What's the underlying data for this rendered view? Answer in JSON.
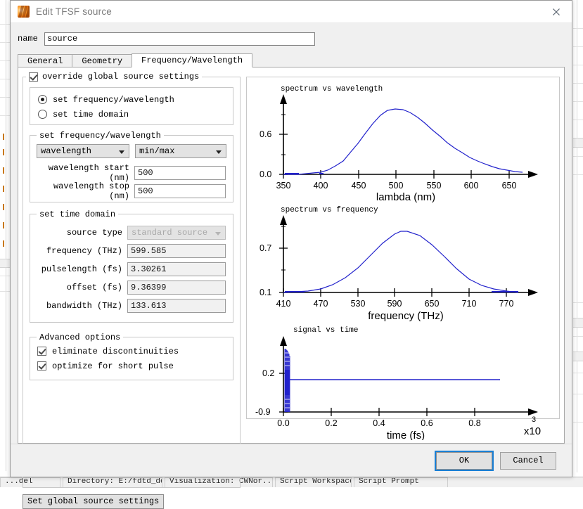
{
  "window": {
    "title": "Edit TFSF source",
    "app_icon": "lumerical-flame-icon",
    "close_icon": "close-icon"
  },
  "name_field": {
    "label": "name",
    "value": "source",
    "placeholder": ""
  },
  "tabs": [
    {
      "label": "General",
      "active": false
    },
    {
      "label": "Geometry",
      "active": false
    },
    {
      "label": "Frequency/Wavelength",
      "active": true
    }
  ],
  "override_group": {
    "legend": "override global source settings",
    "checked": true
  },
  "mode_group": {
    "options": [
      {
        "label": "set frequency/wavelength",
        "selected": true
      },
      {
        "label": "set time domain",
        "selected": false
      }
    ]
  },
  "frequency_group": {
    "legend": "set frequency/wavelength",
    "quantity_select": {
      "value": "wavelength"
    },
    "range_select": {
      "value": "min/max"
    },
    "fields": [
      {
        "label": "wavelength start (nm)",
        "value": "500"
      },
      {
        "label": "wavelength stop (nm)",
        "value": "500"
      }
    ]
  },
  "time_group": {
    "legend": "set time domain",
    "source_type": {
      "label": "source type",
      "value": "standard source",
      "disabled": true
    },
    "fields": [
      {
        "label": "frequency (THz)",
        "value": "599.585"
      },
      {
        "label": "pulselength (fs)",
        "value": "3.30261"
      },
      {
        "label": "offset (fs)",
        "value": "9.36399"
      },
      {
        "label": "bandwidth (THz)",
        "value": "133.613"
      }
    ]
  },
  "advanced_group": {
    "legend": "Advanced options",
    "options": [
      {
        "label": "eliminate discontinuities",
        "checked": true
      },
      {
        "label": "optimize for short pulse",
        "checked": true
      }
    ]
  },
  "set_global_button": {
    "label": "Set global source settings"
  },
  "footer": {
    "ok_label": "OK",
    "cancel_label": "Cancel",
    "default_button": "OK"
  },
  "colors": {
    "curve": "#2222cc",
    "axis": "#000000",
    "tick_label": "#000000",
    "focus_ring": "#1a7fd4",
    "dialog_bg": "#f0f0f0",
    "accent_icon": "#f07c12"
  },
  "host_statusbar": {
    "cells": [
      "...del",
      "Directory: E:/fdtd_dev...",
      "Visualization: CWNor...",
      "Script Workspace",
      "Script Prompt"
    ]
  },
  "chart_data": [
    {
      "id": "spectrum-vs-wavelength",
      "type": "line",
      "title": "spectrum vs wavelength",
      "xlabel": "lambda (nm)",
      "ylabel": "",
      "xlim": [
        350,
        667
      ],
      "ylim": [
        0.0,
        1.0
      ],
      "xticks": [
        350,
        400,
        450,
        500,
        550,
        600,
        650
      ],
      "yticks": [
        0.0,
        0.6
      ],
      "ytick_labels": [
        "0.0",
        "0.6"
      ],
      "grid": false,
      "legend": "none",
      "series": [
        {
          "name": "spectrum",
          "x": [
            350,
            360,
            370,
            380,
            390,
            400,
            410,
            420,
            430,
            440,
            450,
            460,
            470,
            480,
            490,
            500,
            510,
            520,
            530,
            540,
            550,
            560,
            570,
            580,
            590,
            600,
            610,
            620,
            630,
            640,
            650,
            660,
            667
          ],
          "y": [
            0.0,
            0.0,
            0.0,
            0.005,
            0.012,
            0.028,
            0.06,
            0.115,
            0.2,
            0.31,
            0.44,
            0.58,
            0.71,
            0.82,
            0.885,
            0.905,
            0.895,
            0.86,
            0.8,
            0.73,
            0.645,
            0.56,
            0.475,
            0.395,
            0.325,
            0.26,
            0.21,
            0.165,
            0.125,
            0.095,
            0.07,
            0.05,
            0.04
          ]
        }
      ]
    },
    {
      "id": "spectrum-vs-frequency",
      "type": "line",
      "title": "spectrum vs frequency",
      "xlabel": "frequency (THz)",
      "ylabel": "",
      "xlim": [
        410,
        790
      ],
      "ylim": [
        0.1,
        1.0
      ],
      "xticks": [
        410,
        470,
        530,
        590,
        650,
        710,
        770
      ],
      "yticks": [
        0.1,
        0.7
      ],
      "ytick_labels": [
        "0.1",
        "0.7"
      ],
      "grid": false,
      "legend": "none",
      "series": [
        {
          "name": "spectrum",
          "x": [
            410,
            430,
            450,
            470,
            490,
            510,
            530,
            550,
            570,
            590,
            600,
            610,
            630,
            650,
            670,
            690,
            710,
            730,
            750,
            770,
            790
          ],
          "y": [
            0.1,
            0.105,
            0.115,
            0.14,
            0.19,
            0.28,
            0.41,
            0.57,
            0.73,
            0.86,
            0.885,
            0.885,
            0.83,
            0.71,
            0.55,
            0.39,
            0.25,
            0.16,
            0.12,
            0.105,
            0.1
          ]
        }
      ]
    },
    {
      "id": "signal-vs-time",
      "type": "line",
      "title": "signal vs time",
      "xlabel": "time (fs)",
      "x_exponent_label": "x10",
      "x_exponent_power": "3",
      "ylabel": "",
      "xlim": [
        0.0,
        1.0
      ],
      "ylim": [
        -0.9,
        1.0
      ],
      "xticks": [
        0.0,
        0.2,
        0.4,
        0.6,
        0.8
      ],
      "yticks": [
        -0.9,
        0.2
      ],
      "ytick_labels": [
        "-0.9",
        "0.2"
      ],
      "grid": false,
      "legend": "none",
      "notes": "narrow oscillatory burst at t~0 spanning full y range, then flat baseline near y=0.1",
      "series": [
        {
          "name": "signal",
          "baseline_y": 0.1,
          "burst_x_range": [
            0.0,
            0.012
          ],
          "burst_y_range": [
            -0.9,
            0.95
          ]
        }
      ]
    }
  ]
}
